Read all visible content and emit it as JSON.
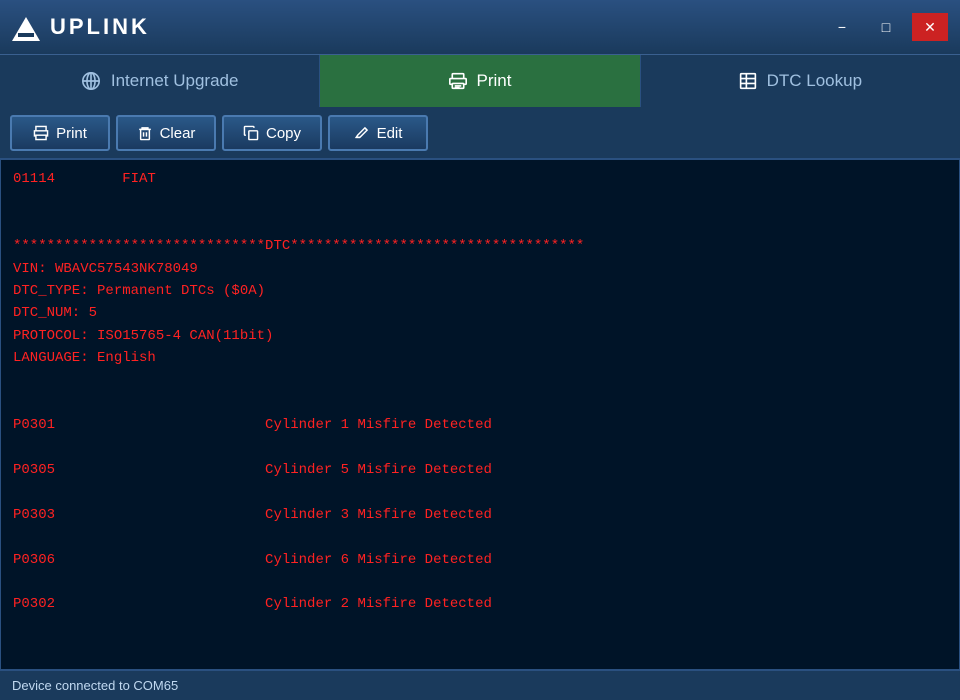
{
  "window": {
    "title": "UPLINK",
    "minimize_label": "−",
    "restore_label": "□",
    "close_label": "✕"
  },
  "tabs": [
    {
      "id": "internet-upgrade",
      "label": "Internet Upgrade",
      "active": false
    },
    {
      "id": "print",
      "label": "Print",
      "active": true
    },
    {
      "id": "dtc-lookup",
      "label": "DTC Lookup",
      "active": false
    }
  ],
  "toolbar": {
    "print_label": "Print",
    "clear_label": "Clear",
    "copy_label": "Copy",
    "edit_label": "Edit"
  },
  "content": {
    "text": "01114        FIAT\n\n\n******************************DTC***********************************\nVIN: WBAVC57543NK78049\nDTC_TYPE: Permanent DTCs ($0A)\nDTC_NUM: 5\nPROTOCOL: ISO15765-4 CAN(11bit)\nLANGUAGE: English\n\n\nP0301                         Cylinder 1 Misfire Detected\n\nP0305                         Cylinder 5 Misfire Detected\n\nP0303                         Cylinder 3 Misfire Detected\n\nP0306                         Cylinder 6 Misfire Detected\n\nP0302                         Cylinder 2 Misfire Detected"
  },
  "status_bar": {
    "text": "Device connected to COM65"
  }
}
